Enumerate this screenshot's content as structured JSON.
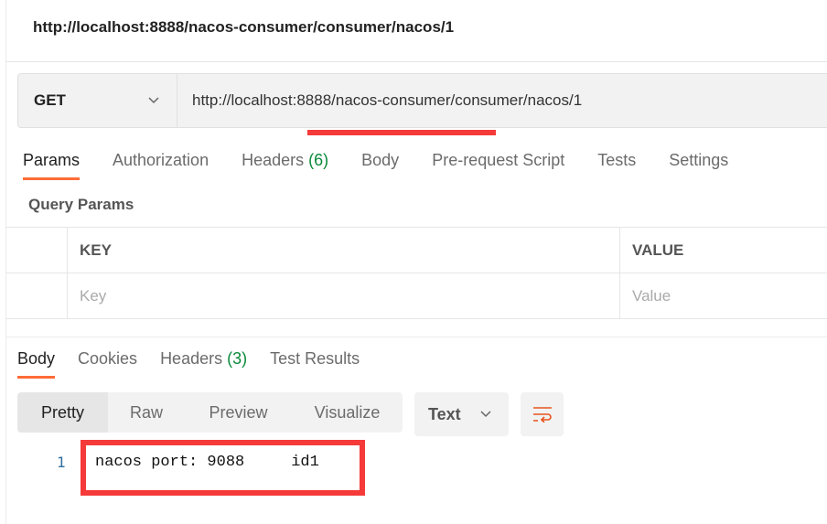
{
  "title": "http://localhost:8888/nacos-consumer/consumer/nacos/1",
  "request": {
    "method": "GET",
    "url": "http://localhost:8888/nacos-consumer/consumer/nacos/1",
    "tabs": [
      {
        "label": "Params",
        "count": ""
      },
      {
        "label": "Authorization",
        "count": ""
      },
      {
        "label": "Headers",
        "count": "(6)"
      },
      {
        "label": "Body",
        "count": ""
      },
      {
        "label": "Pre-request Script",
        "count": ""
      },
      {
        "label": "Tests",
        "count": ""
      },
      {
        "label": "Settings",
        "count": ""
      }
    ],
    "query_params_label": "Query Params",
    "table": {
      "key_header": "KEY",
      "value_header": "VALUE",
      "key_placeholder": "Key",
      "value_placeholder": "Value"
    }
  },
  "response": {
    "tabs": [
      {
        "label": "Body",
        "count": ""
      },
      {
        "label": "Cookies",
        "count": ""
      },
      {
        "label": "Headers",
        "count": "(3)"
      },
      {
        "label": "Test Results",
        "count": ""
      }
    ],
    "views": [
      "Pretty",
      "Raw",
      "Preview",
      "Visualize"
    ],
    "format": "Text",
    "line_number": "1",
    "body": "nacos port: 9088     id1"
  },
  "colors": {
    "accent": "#ff6c37",
    "highlight": "#f53a3a",
    "count": "#0a8a3a"
  }
}
